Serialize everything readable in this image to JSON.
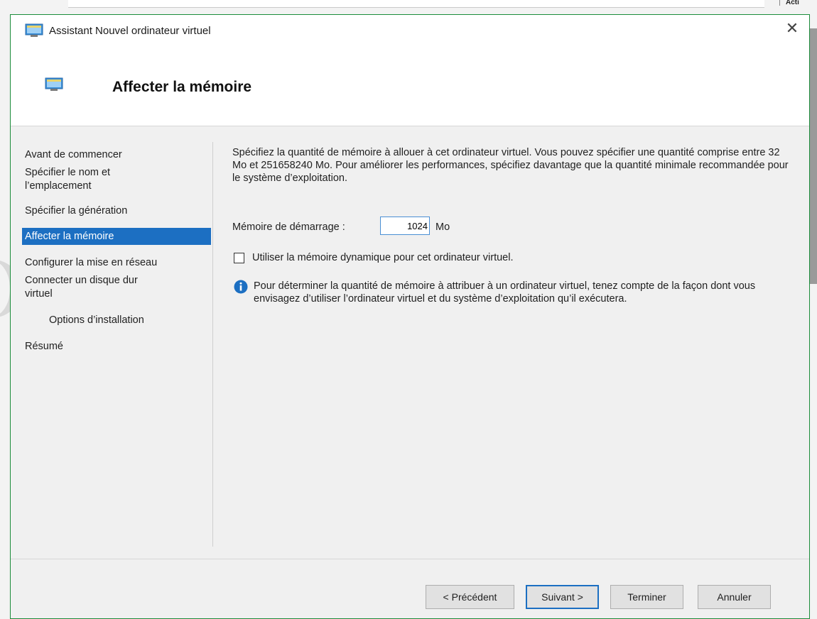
{
  "background": {
    "partial_label": "Acti"
  },
  "dialog": {
    "title": "Assistant Nouvel ordinateur virtuel",
    "close_glyph": "✕",
    "page_title": "Affecter la mémoire",
    "accent_color": "#1c6fc2",
    "border_color": "#1b8c3a"
  },
  "steps": [
    {
      "label": "Avant de commencer"
    },
    {
      "label": "Spécifier le nom et\nl’emplacement"
    },
    {
      "label": "Spécifier la génération"
    },
    {
      "label": "Affecter la mémoire",
      "active": true
    },
    {
      "label": "Configurer la mise en réseau"
    },
    {
      "label": "Connecter un disque dur\nvirtuel"
    },
    {
      "label": "Options d’installation",
      "sub": true
    },
    {
      "label": "Résumé"
    }
  ],
  "main": {
    "description": "Spécifiez la quantité de mémoire à allouer à cet ordinateur virtuel. Vous pouvez spécifier une quantité comprise entre 32 Mo et 251658240 Mo. Pour améliorer les performances, spécifiez davantage que la quantité minimale recommandée pour le système d’exploitation.",
    "memory_label": "Mémoire de démarrage :",
    "memory_value": "1024",
    "memory_unit": "Mo",
    "dynamic_memory_label": "Utiliser la mémoire dynamique pour cet ordinateur virtuel.",
    "dynamic_memory_checked": false,
    "info_text": "Pour déterminer la quantité de mémoire à attribuer à un ordinateur virtuel, tenez compte de la façon dont vous envisagez d’utiliser l’ordinateur virtuel et du système d’exploitation qu’il exécutera."
  },
  "footer": {
    "previous_label": "< Précédent",
    "next_label": "Suivant >",
    "finish_label": "Terminer",
    "cancel_label": "Annuler"
  }
}
